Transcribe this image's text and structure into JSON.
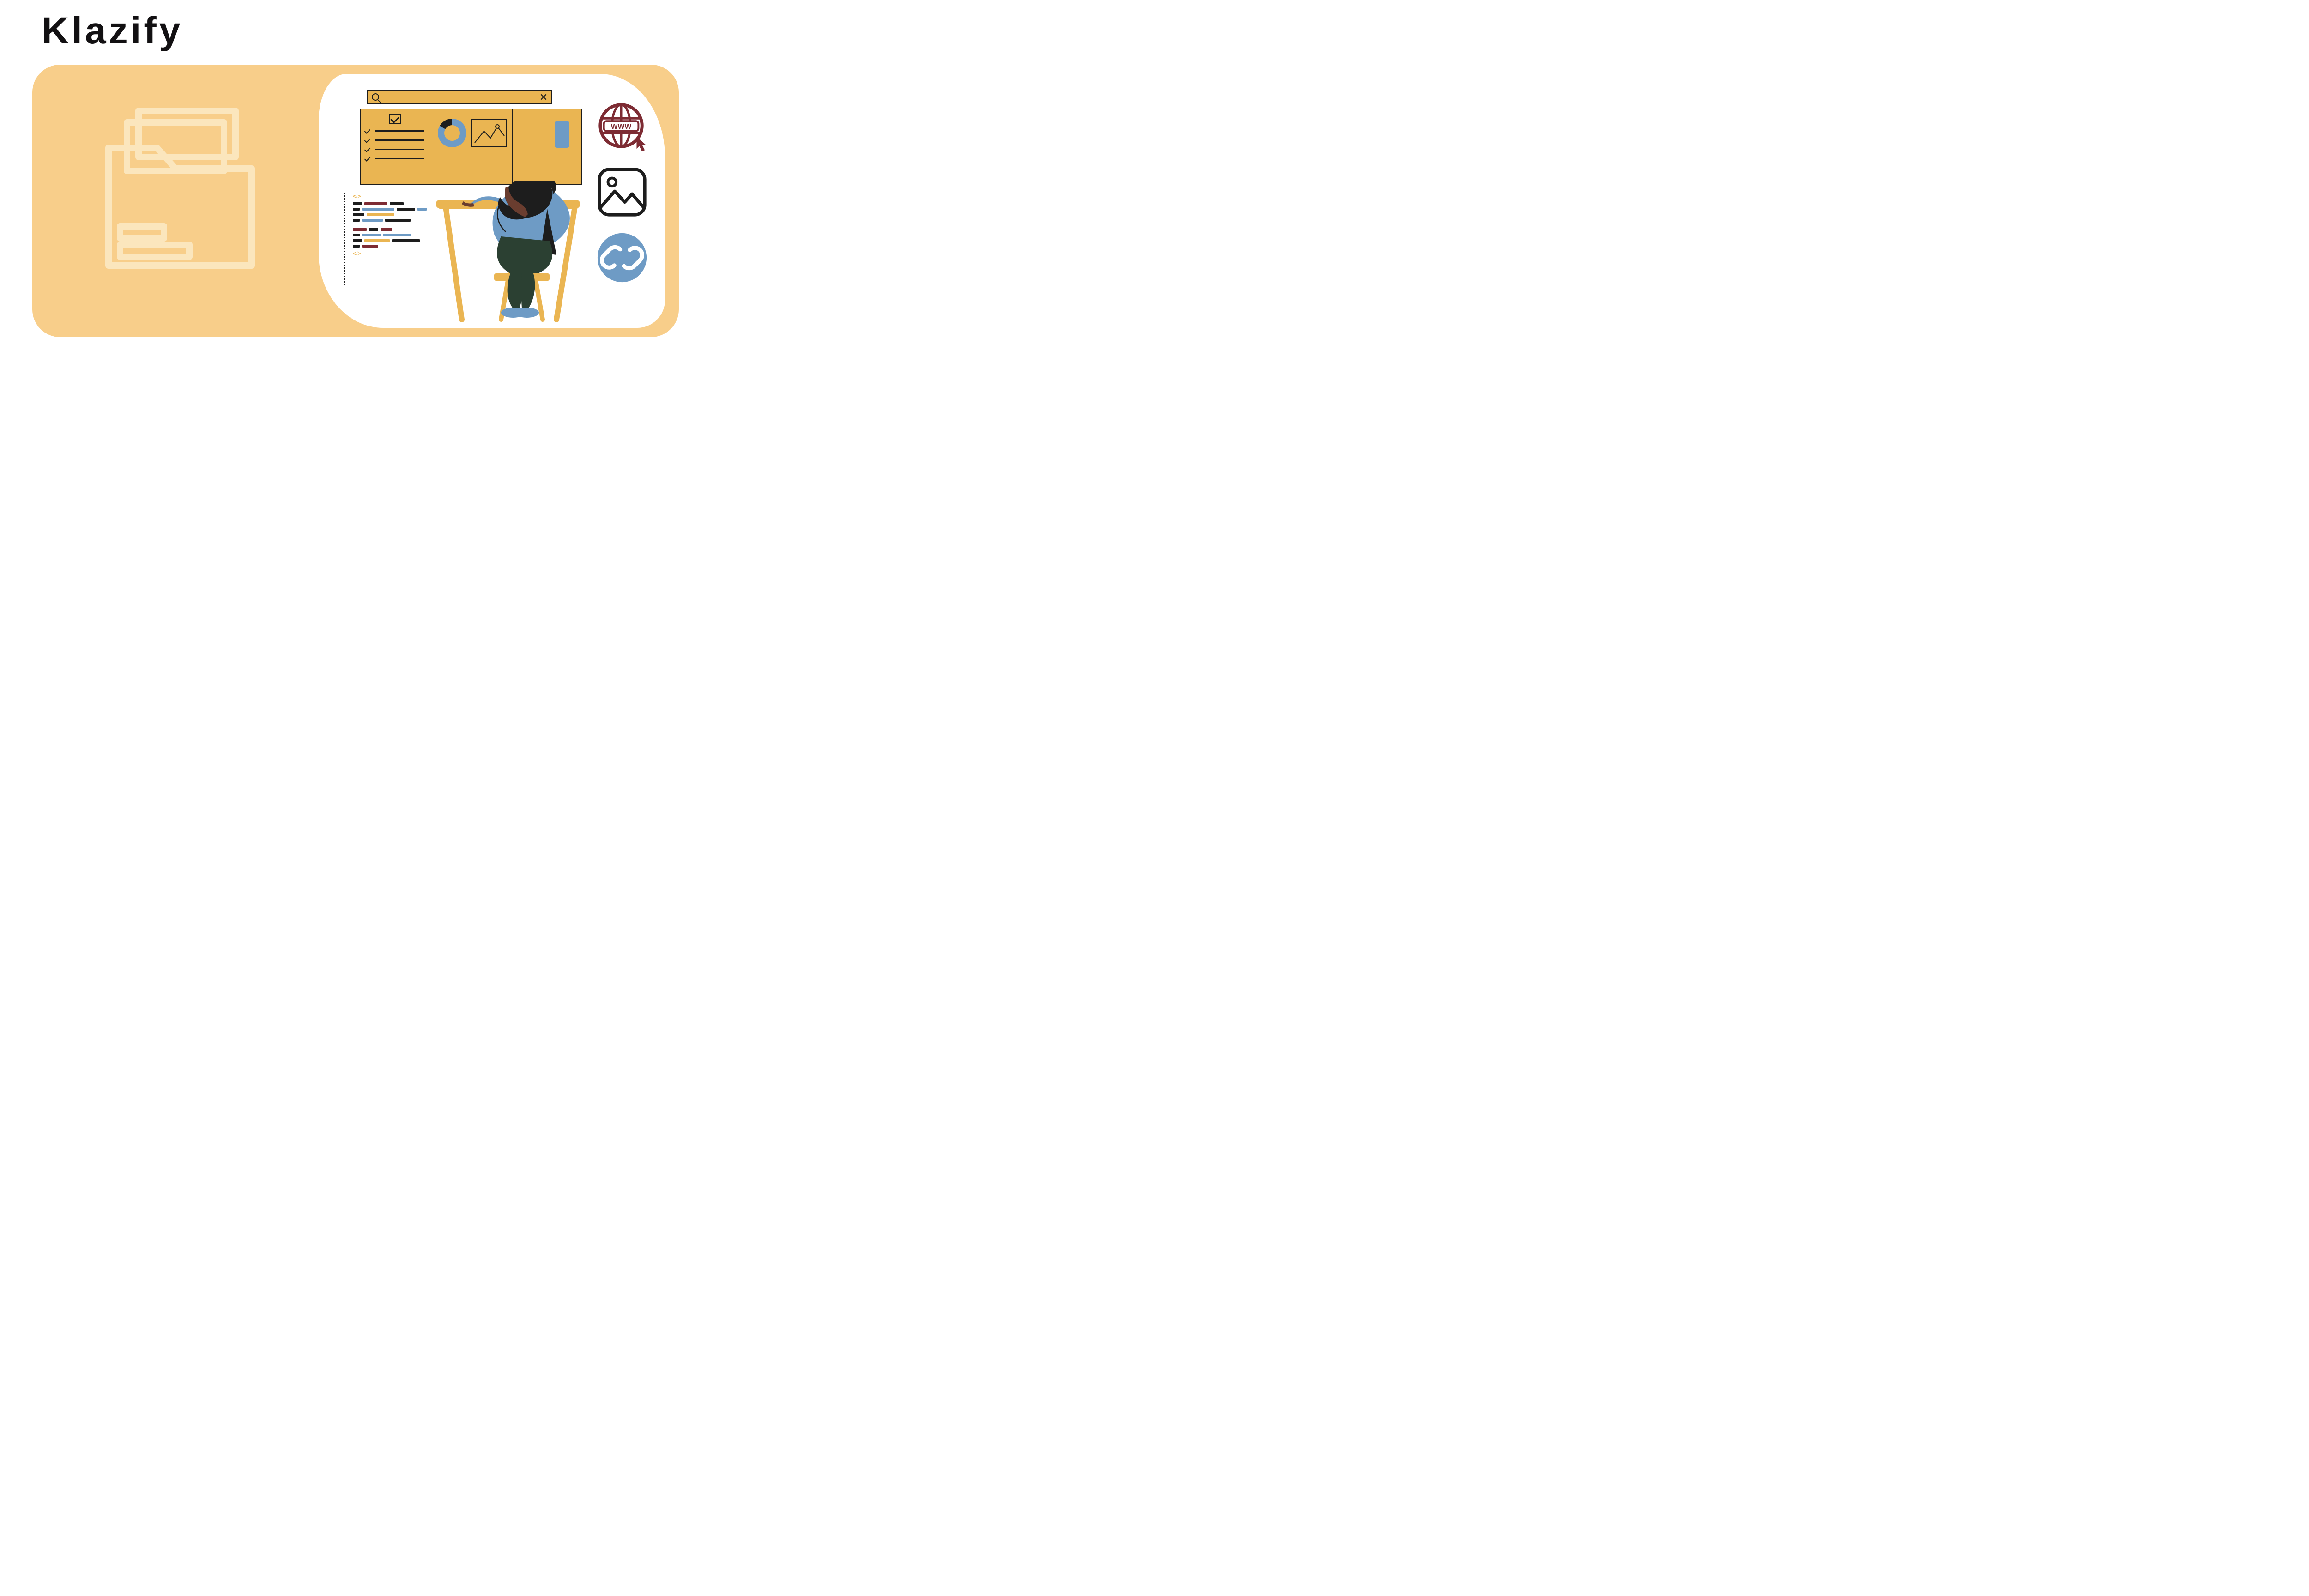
{
  "brand": {
    "title": "Klazify"
  },
  "colors": {
    "card_bg": "#f8ce8a",
    "panel_bg": "#eab552",
    "accent_blue": "#6e9bc5",
    "accent_maroon": "#7d2b33",
    "ink": "#1d1d1d",
    "cream": "#fbe6bd"
  },
  "icons": {
    "www_label": "WWW"
  }
}
